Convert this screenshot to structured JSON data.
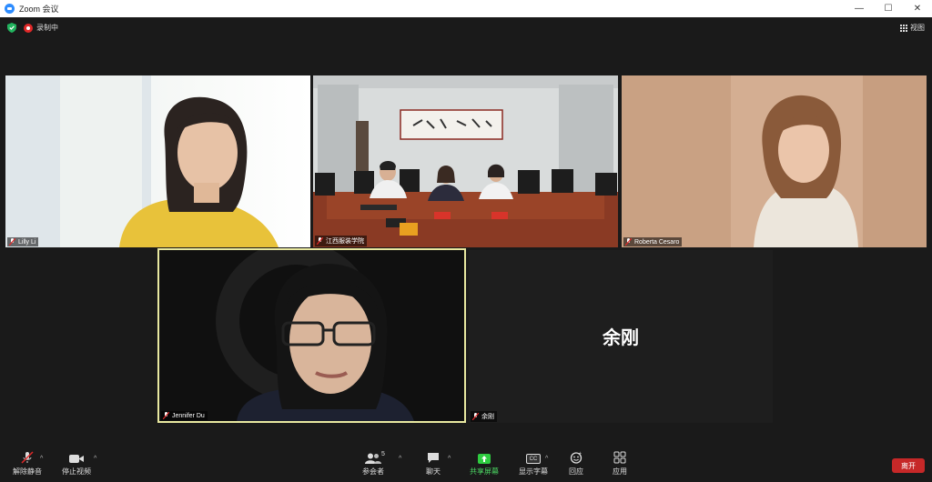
{
  "window": {
    "title": "Zoom 会议",
    "minimize": "—",
    "maximize": "☐",
    "close": "✕"
  },
  "status": {
    "recording_label": "录制中",
    "view_label": "视图"
  },
  "tiles": {
    "lilly": {
      "name": "Lilly Li"
    },
    "room": {
      "name": "江西服装学院"
    },
    "roberta": {
      "name": "Roberta Cesaro"
    },
    "jennifer": {
      "name": "Jennifer Du"
    },
    "yugang": {
      "name": "余刚",
      "display_name": "余刚"
    }
  },
  "toolbar": {
    "unmute_label": "解除静音",
    "stop_video_label": "停止视频",
    "participants_label": "参会者",
    "participants_count": "5",
    "chat_label": "聊天",
    "share_label": "共享屏幕",
    "captions_label": "显示字幕",
    "captions_icon_text": "CC",
    "reactions_label": "回应",
    "apps_label": "应用",
    "leave_label": "离开"
  },
  "colors": {
    "accent_share": "#4cd964",
    "leave": "#c62828",
    "active_speaker_border": "#e8e8a0",
    "record": "#e02828"
  }
}
